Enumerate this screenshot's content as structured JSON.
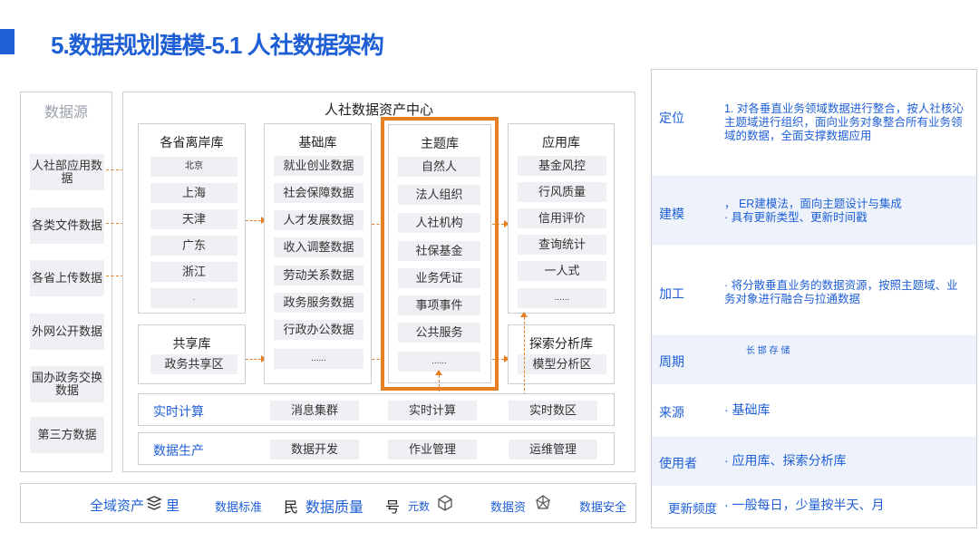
{
  "header": {
    "title": "5.数据规划建模-5.1 人社数据架构"
  },
  "sources": {
    "title": "数据源",
    "items": [
      "人社部应用数据",
      "各类文件数据",
      "各省上传数据",
      "外网公开数据",
      "国办政务交换数据",
      "第三方数据"
    ]
  },
  "center": {
    "title": "人社数据资产中心",
    "provincial": {
      "title": "各省离岸库",
      "items": [
        "北京",
        "上海",
        "天津",
        "广东",
        "浙江",
        "."
      ]
    },
    "shared": {
      "title": "共享库",
      "items": [
        "政务共享区"
      ]
    },
    "base": {
      "title": "基础库",
      "items": [
        "就业创业数据",
        "社会保障数据",
        "人才发展数据",
        "收入调整数据",
        "劳动关系数据",
        "政务服务数据",
        "行政办公数据",
        "......"
      ]
    },
    "subject": {
      "title": "主题库",
      "items": [
        "自然人",
        "法人组织",
        "人社机构",
        "社保基金",
        "业务凭证",
        "事项事件",
        "公共服务",
        "......"
      ]
    },
    "application": {
      "title": "应用库",
      "items": [
        "基金风控",
        "行风质量",
        "信用评价",
        "查询统计",
        "一人式",
        "......"
      ]
    },
    "explore": {
      "title": "探索分析库",
      "items": [
        "模型分析区"
      ]
    },
    "realtime": {
      "label": "实时计算",
      "items": [
        "消息集群",
        "实时计算",
        "实时数区"
      ]
    },
    "production": {
      "label": "数据生产",
      "items": [
        "数据开发",
        "作业管理",
        "运维管理"
      ]
    }
  },
  "footer": {
    "items": [
      "全域资产",
      "里",
      "数据标准",
      "民",
      "数据质量",
      "号",
      "元数",
      "数据资",
      "数据安全"
    ],
    "icons": [
      "stack-icon",
      "cube-icon",
      "network-icon"
    ]
  },
  "right": {
    "rows": [
      {
        "label": "定位",
        "text": "1. 对各垂直业务领域数据进行整合，按人社核沁主题域进行组织，面向业务对象整合所有业务领域的数据，全面支撑数据应用"
      },
      {
        "label": "建模",
        "text": "，  ER建模法，面向主题设计与集成\n·  具有更新类型、更新时间戳"
      },
      {
        "label": "加工",
        "text": "·  将分散垂直业务的数据资源，按照主题域、业务对象进行融合与拉通数据"
      },
      {
        "label": "周期",
        "text": "长 邯 存 储"
      },
      {
        "label": "来源",
        "text": "·   基础库"
      },
      {
        "label": "使用者",
        "text": "·   应用库、探索分析库"
      },
      {
        "label": "更新频度",
        "text": "·   一般每日，少量按半天、月"
      }
    ]
  },
  "colors": {
    "primary": "#1f5fd6",
    "accent": "#e67e22",
    "cell": "#eef0f3"
  }
}
